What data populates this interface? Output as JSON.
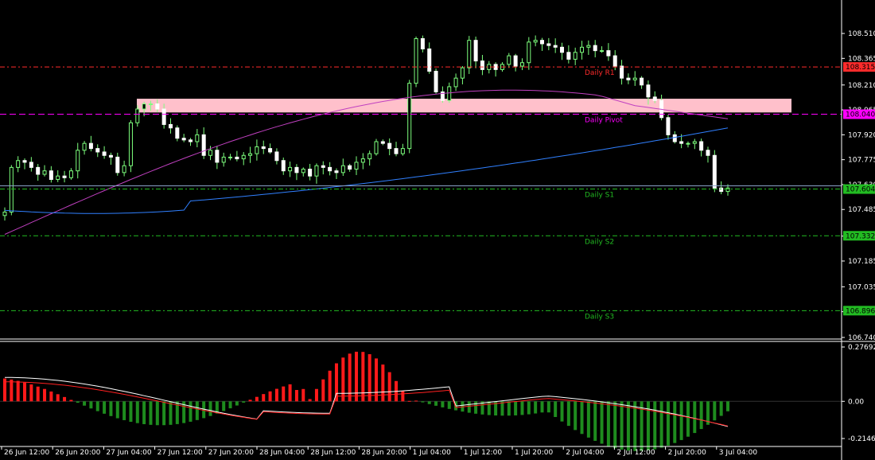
{
  "chart_data": [
    {
      "type": "candlestick",
      "ylim": [
        106.74,
        108.64
      ],
      "y_ticks": [
        "108.510",
        "108.365",
        "108.210",
        "108.065",
        "107.920",
        "107.775",
        "107.630",
        "107.485",
        "107.330",
        "107.185",
        "107.035",
        "106.890",
        "106.740"
      ],
      "current_price": "107.604",
      "levels": [
        {
          "label": "Daily R1",
          "value": 108.315,
          "value_text": "108.315",
          "color": "#ff2b2b"
        },
        {
          "label": "Daily Pivot",
          "value": 108.04,
          "value_text": "108.040",
          "color": "#ff00ff"
        },
        {
          "label": "Daily S1",
          "value": 107.604,
          "value_text": "107.604",
          "color": "#22bb22"
        },
        {
          "label": "Daily S2",
          "value": 107.332,
          "value_text": "107.332",
          "color": "#22bb22"
        },
        {
          "label": "Daily S3",
          "value": 106.896,
          "value_text": "106.896",
          "color": "#22bb22"
        }
      ],
      "zone": {
        "low": 108.05,
        "high": 108.13,
        "color": "#ffc0cb"
      },
      "close": [
        107.47,
        107.73,
        107.77,
        107.76,
        107.73,
        107.69,
        107.71,
        107.66,
        107.68,
        107.67,
        107.71,
        107.83,
        107.87,
        107.84,
        107.82,
        107.8,
        107.79,
        107.7,
        107.74,
        107.99,
        108.07,
        108.1,
        108.1,
        108.07,
        107.98,
        107.96,
        107.9,
        107.89,
        107.88,
        107.92,
        107.8,
        107.83,
        107.76,
        107.79,
        107.79,
        107.78,
        107.8,
        107.81,
        107.85,
        107.84,
        107.82,
        107.77,
        107.71,
        107.73,
        107.7,
        107.72,
        107.68,
        107.74,
        107.73,
        107.71,
        107.7,
        107.74,
        107.72,
        107.76,
        107.78,
        107.81,
        107.88,
        107.87,
        107.84,
        107.81,
        107.84,
        108.22,
        108.48,
        108.42,
        108.29,
        108.17,
        108.12,
        108.2,
        108.25,
        108.31,
        108.47,
        108.35,
        108.3,
        108.33,
        108.3,
        108.33,
        108.38,
        108.32,
        108.34,
        108.46,
        108.47,
        108.45,
        108.44,
        108.43,
        108.4,
        108.36,
        108.4,
        108.43,
        108.44,
        108.41,
        108.41,
        108.38,
        108.32,
        108.25,
        108.24,
        108.25,
        108.21,
        108.14,
        108.12,
        108.02,
        107.92,
        107.88,
        107.87,
        107.87,
        107.88,
        107.83,
        107.8,
        107.61,
        107.59,
        107.61
      ],
      "ma_fast": {
        "color": "#c040c0",
        "start": 107.34,
        "peak": 108.18
      },
      "ma_slow": {
        "color": "#3080ff",
        "start": 107.48,
        "end": 107.96
      }
    },
    {
      "type": "macd",
      "ylim": [
        -0.2147,
        0.2769
      ],
      "y_ticks": [
        "0.27692",
        "0.00",
        "-0.21466"
      ],
      "histogram_up_color": "#ff1a1a",
      "histogram_down_color": "#1e8c1e",
      "main_color": "#ffffff",
      "signal_color": "#ff2020"
    }
  ],
  "x_axis": {
    "labels": [
      "26 Jun 12:00",
      "26 Jun 20:00",
      "27 Jun 04:00",
      "27 Jun 12:00",
      "27 Jun 20:00",
      "28 Jun 04:00",
      "28 Jun 12:00",
      "28 Jun 20:00",
      "1 Jul 04:00",
      "1 Jul 12:00",
      "1 Jul 20:00",
      "2 Jul 04:00",
      "2 Jul 12:00",
      "2 Jul 20:00",
      "3 Jul 04:00"
    ]
  }
}
